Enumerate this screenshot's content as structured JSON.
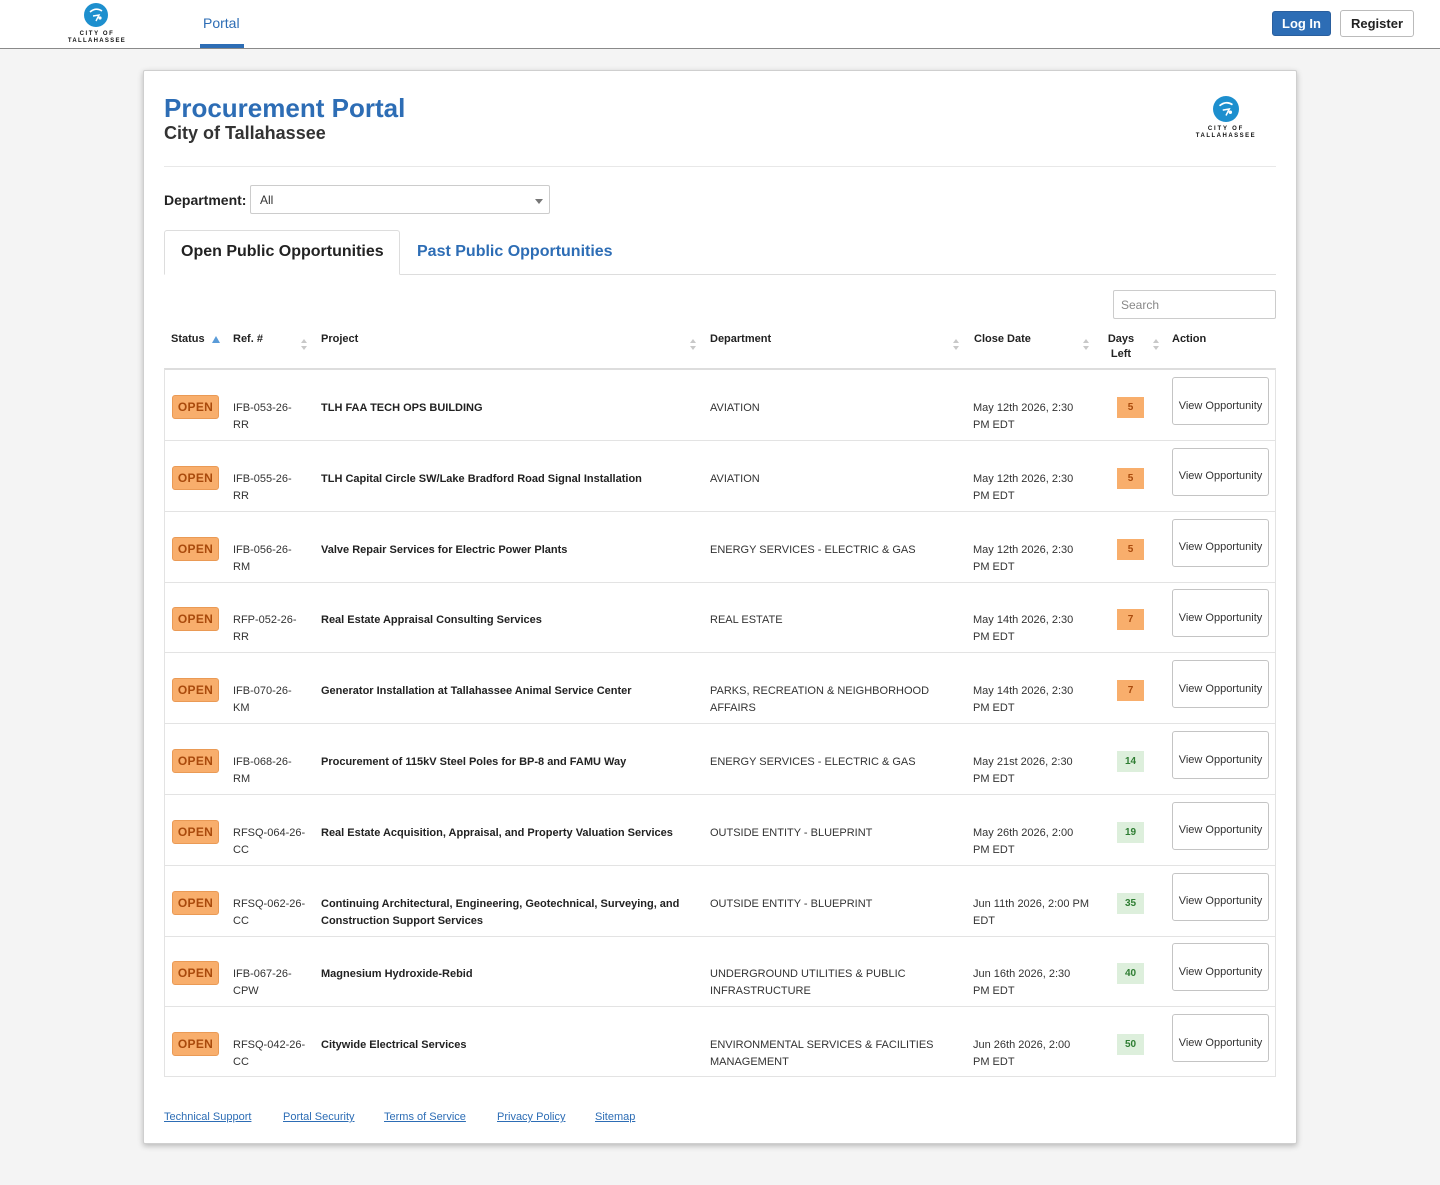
{
  "header": {
    "logo_line1": "CITY OF",
    "logo_line2": "TALLAHASSEE",
    "nav_portal": "Portal",
    "login_label": "Log In",
    "register_label": "Register"
  },
  "portal": {
    "title": "Procurement Portal",
    "subtitle": "City of Tallahassee",
    "logo_line1": "CITY OF",
    "logo_line2": "TALLAHASSEE"
  },
  "filter": {
    "department_label": "Department:",
    "department_value": "All"
  },
  "tabs": {
    "open": "Open Public Opportunities",
    "past": "Past Public Opportunities"
  },
  "search": {
    "placeholder": "Search"
  },
  "columns": {
    "status": "Status",
    "ref": "Ref. #",
    "project": "Project",
    "department": "Department",
    "close_date": "Close Date",
    "days_left": "Days Left",
    "action": "Action"
  },
  "rows": [
    {
      "status": "OPEN",
      "ref": "IFB-053-26-RR",
      "project": "TLH FAA TECH OPS BUILDING",
      "department": "AVIATION",
      "close_date": "May 12th 2026, 2:30 PM EDT",
      "days_left": "5",
      "action": "View Opportunity"
    },
    {
      "status": "OPEN",
      "ref": "IFB-055-26-RR",
      "project": "TLH Capital Circle SW/Lake Bradford Road Signal Installation",
      "department": "AVIATION",
      "close_date": "May 12th 2026, 2:30 PM EDT",
      "days_left": "5",
      "action": "View Opportunity"
    },
    {
      "status": "OPEN",
      "ref": "IFB-056-26-RM",
      "project": "Valve Repair Services for Electric Power Plants",
      "department": "ENERGY SERVICES - ELECTRIC & GAS",
      "close_date": "May 12th 2026, 2:30 PM EDT",
      "days_left": "5",
      "action": "View Opportunity"
    },
    {
      "status": "OPEN",
      "ref": "RFP-052-26-RR",
      "project": "Real Estate Appraisal Consulting Services",
      "department": "REAL ESTATE",
      "close_date": "May 14th 2026, 2:30 PM EDT",
      "days_left": "7",
      "action": "View Opportunity"
    },
    {
      "status": "OPEN",
      "ref": "IFB-070-26-KM",
      "project": "Generator Installation at Tallahassee Animal Service Center",
      "department": "PARKS, RECREATION & NEIGHBORHOOD AFFAIRS",
      "close_date": "May 14th 2026, 2:30 PM EDT",
      "days_left": "7",
      "action": "View Opportunity"
    },
    {
      "status": "OPEN",
      "ref": "IFB-068-26-RM",
      "project": "Procurement of 115kV Steel Poles for BP-8 and FAMU Way",
      "department": "ENERGY SERVICES - ELECTRIC & GAS",
      "close_date": "May 21st 2026, 2:30 PM EDT",
      "days_left": "14",
      "action": "View Opportunity"
    },
    {
      "status": "OPEN",
      "ref": "RFSQ-064-26-CC",
      "project": "Real Estate Acquisition, Appraisal, and Property Valuation Services",
      "department": "OUTSIDE ENTITY - BLUEPRINT",
      "close_date": "May 26th 2026, 2:00 PM EDT",
      "days_left": "19",
      "action": "View Opportunity"
    },
    {
      "status": "OPEN",
      "ref": "RFSQ-062-26-CC",
      "project": "Continuing Architectural, Engineering, Geotechnical, Surveying, and Construction Support Services",
      "department": "OUTSIDE ENTITY - BLUEPRINT",
      "close_date": "Jun 11th 2026, 2:00 PM EDT",
      "days_left": "35",
      "action": "View Opportunity"
    },
    {
      "status": "OPEN",
      "ref": "IFB-067-26-CPW",
      "project": "Magnesium Hydroxide-Rebid",
      "department": "UNDERGROUND UTILITIES & PUBLIC INFRASTRUCTURE",
      "close_date": "Jun 16th 2026, 2:30 PM EDT",
      "days_left": "40",
      "action": "View Opportunity"
    },
    {
      "status": "OPEN",
      "ref": "RFSQ-042-26-CC",
      "project": "Citywide Electrical Services",
      "department": "ENVIRONMENTAL SERVICES & FACILITIES MANAGEMENT",
      "close_date": "Jun 26th 2026, 2:00 PM EDT",
      "days_left": "50",
      "action": "View Opportunity"
    }
  ],
  "footer": {
    "links": [
      "Technical Support",
      "Portal Security",
      "Terms of Service",
      "Privacy Policy",
      "Sitemap"
    ]
  },
  "colors": {
    "primary": "#2d6db5",
    "logo_blue": "#1d8fce",
    "badge_orange": "#f8ae6c",
    "days_green_bg": "#ddefdc"
  }
}
